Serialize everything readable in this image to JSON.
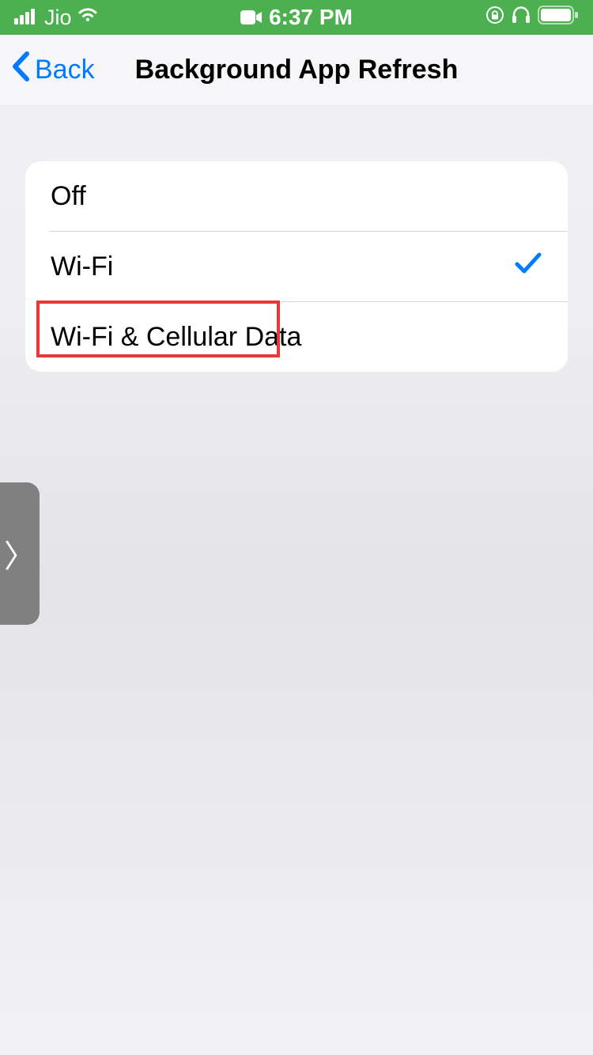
{
  "statusBar": {
    "carrier": "Jio",
    "time": "6:37 PM"
  },
  "nav": {
    "backLabel": "Back",
    "title": "Background App Refresh"
  },
  "options": {
    "items": [
      {
        "label": "Off",
        "selected": false,
        "highlighted": false
      },
      {
        "label": "Wi-Fi",
        "selected": true,
        "highlighted": false
      },
      {
        "label": "Wi-Fi & Cellular Data",
        "selected": false,
        "highlighted": true
      }
    ]
  },
  "colors": {
    "statusBar": "#4caf50",
    "accent": "#007aff",
    "highlight": "#e53935"
  }
}
